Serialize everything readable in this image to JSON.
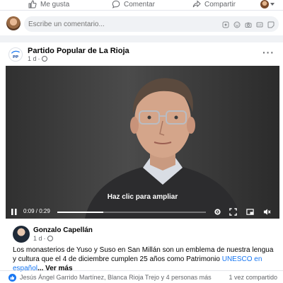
{
  "actions": {
    "like": "Me gusta",
    "comment": "Comentar",
    "share": "Compartir"
  },
  "comment_box": {
    "placeholder": "Escribe un comentario..."
  },
  "post": {
    "page_name": "Partido Popular de La Rioja",
    "timestamp": "1 d",
    "more": "···",
    "video": {
      "caption": "Haz clic para ampliar",
      "time": "0:09 / 0:29",
      "progress": 0.31
    },
    "author": {
      "name": "Gonzalo Capellán",
      "timestamp": "1 d"
    },
    "text": "Los monasterios de Yuso y Suso en San Millán son un emblema de nuestra lengua y cultura que el 4 de diciembre cumplen 25 años como Patrimonio ",
    "text_link": "UNESCO en español",
    "text_more": "... Ver más",
    "reactions": "Jesús Ángel Garrido Martínez, Blanca Rioja Trejo y 4 personas más",
    "shares": "1 vez compartido"
  },
  "colors": {
    "brand": "#1877f2",
    "secondary_text": "#65676b"
  }
}
